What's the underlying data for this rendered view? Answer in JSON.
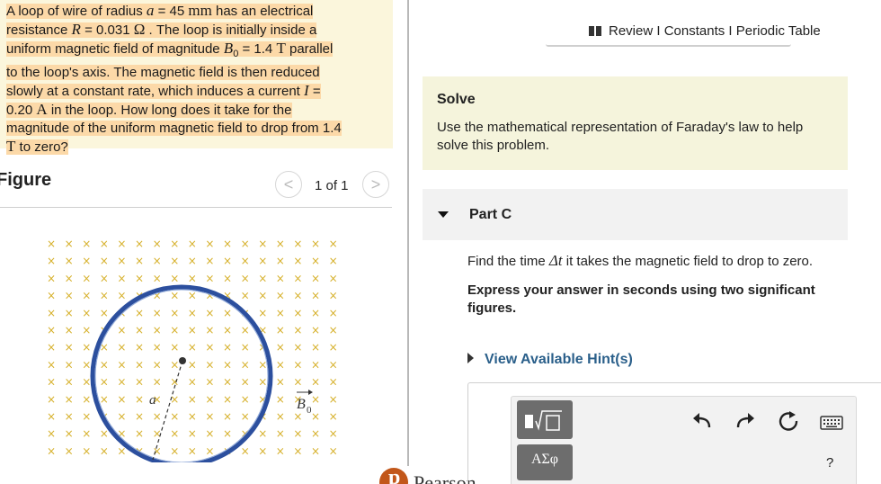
{
  "problem": {
    "lines": [
      [
        "A loop of wire of radius ",
        {
          "mi": "a"
        },
        " = 45 ",
        {
          "m": "mm"
        },
        " has an electrical"
      ],
      [
        "resistance ",
        {
          "mi": "R"
        },
        " = 0.031 ",
        {
          "m": "Ω"
        },
        " . The loop is initially inside a"
      ],
      [
        "uniform magnetic field of magnitude ",
        {
          "mi": "B"
        },
        {
          "sub": "0"
        },
        " = 1.4 ",
        {
          "m": "T"
        },
        " parallel"
      ],
      [
        "to the loop's axis. The magnetic field is then reduced"
      ],
      [
        "slowly at a constant rate, which induces a current ",
        {
          "mi": "I"
        },
        " ="
      ],
      [
        "0.20 ",
        {
          "m": "A"
        },
        " in the loop. How long does it take for the"
      ],
      [
        "magnitude of the uniform magnetic field to drop from 1.4"
      ],
      [
        {
          "m": "T"
        },
        " to zero?"
      ]
    ]
  },
  "figure": {
    "title": "Figure",
    "pager_prev": "<",
    "pager_next": ">",
    "pager_count": "1 of 1",
    "radius_label": "a",
    "field_label": "B",
    "field_subscript": "0",
    "field_symbol": "×",
    "colors": {
      "loop": "#2c4f9e",
      "field_x": "#d6b02a",
      "radius": "#333333"
    }
  },
  "nav": {
    "review": "Review",
    "sep": " I ",
    "constants": "Constants",
    "periodic_table": "Periodic Table"
  },
  "solve": {
    "title": "Solve",
    "text": "Use the mathematical representation of Faraday's law to help solve this problem."
  },
  "part": {
    "title": "Part C",
    "question_before": "Find the time ",
    "question_symbol": "Δt",
    "question_after": " it takes the magnetic field to drop to zero.",
    "instruction": "Express your answer in seconds using two significant figures.",
    "hints_label": "View Available Hint(s)"
  },
  "toolbar": {
    "greek_label": "ΑΣφ",
    "help_label": "?",
    "icons": [
      "templates-icon",
      "undo-icon",
      "redo-icon",
      "reset-icon",
      "keyboard-icon"
    ]
  },
  "brand": {
    "name": "Pearson",
    "color": "#c2571a"
  }
}
